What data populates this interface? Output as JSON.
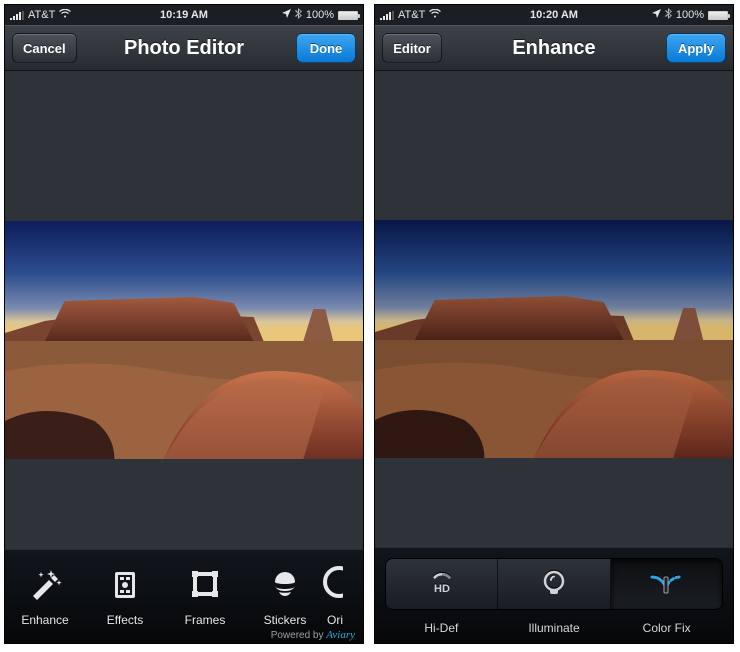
{
  "screen1": {
    "statusbar": {
      "carrier": "AT&T",
      "time": "10:19 AM",
      "battery": "100%"
    },
    "navbar": {
      "left": "Cancel",
      "title": "Photo Editor",
      "right": "Done"
    },
    "tools": [
      {
        "label": "Enhance"
      },
      {
        "label": "Effects"
      },
      {
        "label": "Frames"
      },
      {
        "label": "Stickers"
      },
      {
        "label": "Ori"
      }
    ],
    "footer": {
      "prefix": "Powered by ",
      "brand": "Aviary"
    }
  },
  "screen2": {
    "statusbar": {
      "carrier": "AT&T",
      "time": "10:20 AM",
      "battery": "100%"
    },
    "navbar": {
      "left": "Editor",
      "title": "Enhance",
      "right": "Apply"
    },
    "segments": [
      {
        "label": "Hi-Def"
      },
      {
        "label": "Illuminate"
      },
      {
        "label": "Color Fix"
      }
    ]
  }
}
